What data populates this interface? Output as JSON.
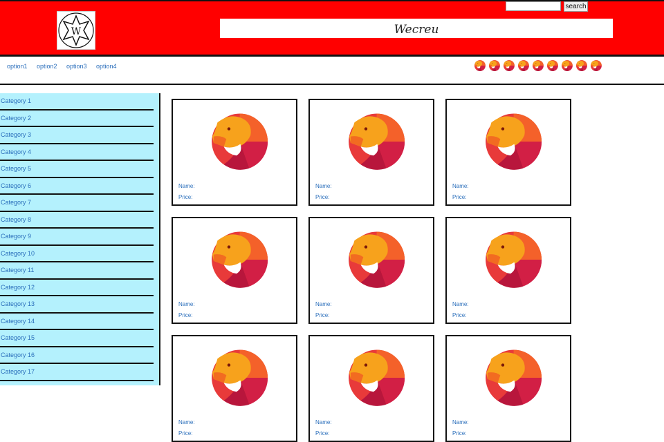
{
  "header": {
    "brand": "Wecreu",
    "logo_letter": "W",
    "search_button": "search",
    "search_value": ""
  },
  "nav": {
    "options": [
      "option1",
      "option2",
      "option3",
      "option4"
    ]
  },
  "sidebar": {
    "categories": [
      "Category 1",
      "Category 2",
      "Category 3",
      "Category 4",
      "Category 5",
      "Category 6",
      "Category 7",
      "Category 8",
      "Category 9",
      "Category 10",
      "Category 11",
      "Category 12",
      "Category 13",
      "Category 14",
      "Category 15",
      "Category 16",
      "Category 17"
    ]
  },
  "products": {
    "name_label": "Name:",
    "price_label": "Price:",
    "count": 9
  },
  "colors": {
    "header_bg": "#ff0000",
    "sidebar_bg": "#b4f1fd",
    "link": "#2a6ebb"
  }
}
